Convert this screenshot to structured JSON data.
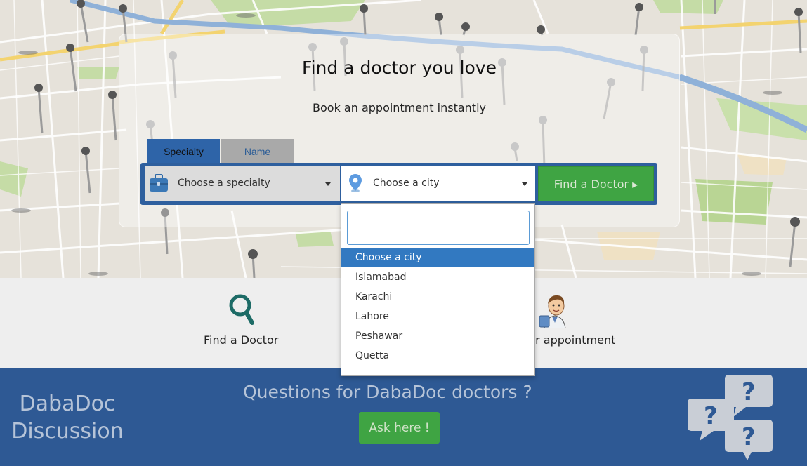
{
  "hero": {
    "headline": "Find a doctor you love",
    "subline": "Book an appointment instantly"
  },
  "search": {
    "tabs": [
      {
        "label": "Specialty",
        "active": true
      },
      {
        "label": "Name",
        "active": false
      }
    ],
    "specialty_placeholder": "Choose a specialty",
    "city_placeholder": "Choose a city",
    "find_button": "Find a Doctor ▸"
  },
  "city_dropdown": {
    "search_value": "",
    "options": [
      "Choose a city",
      "Islamabad",
      "Karachi",
      "Lahore",
      "Peshawar",
      "Quetta"
    ],
    "highlighted_index": 0
  },
  "steps": [
    {
      "label": "Find a Doctor",
      "icon": "search-icon"
    },
    {
      "label": "ur appointment",
      "icon": "doctor-avatar-icon"
    }
  ],
  "discussion": {
    "title": "DabaDoc Discussion",
    "question": "Questions for DabaDoc doctors ?",
    "ask_button": "Ask here !",
    "icon": "question-bubbles-icon"
  },
  "colors": {
    "brand_blue": "#2e5994",
    "tab_active": "#2e64a8",
    "cta_green": "#3fa443",
    "highlight": "#3279c1",
    "step_icon_teal": "#1d6b66"
  }
}
